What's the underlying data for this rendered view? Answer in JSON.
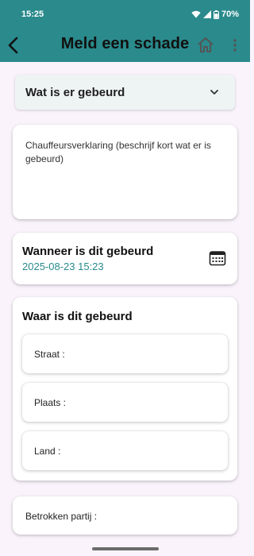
{
  "status": {
    "time": "15:25",
    "battery": "70%"
  },
  "appbar": {
    "title": "Meld een schade"
  },
  "dropdown": {
    "label": "Wat is er gebeurd"
  },
  "statement": {
    "placeholder": "Chauffeursverklaring (beschrijf kort wat er is gebeurd)"
  },
  "when": {
    "title": "Wanneer is dit gebeurd",
    "value": "2025-08-23 15:23"
  },
  "where": {
    "title": "Waar is dit gebeurd",
    "fields": [
      {
        "label": "Straat :"
      },
      {
        "label": "Plaats :"
      },
      {
        "label": "Land :"
      }
    ]
  },
  "party": {
    "label": "Betrokken partij :"
  },
  "colors": {
    "accent": "#2a8a8c",
    "background": "#faf3fb"
  },
  "icons": [
    "back-arrow-icon",
    "home-icon",
    "more-vert-icon",
    "chevron-down-icon",
    "calendar-icon",
    "wifi-icon",
    "signal-icon",
    "battery-icon"
  ]
}
